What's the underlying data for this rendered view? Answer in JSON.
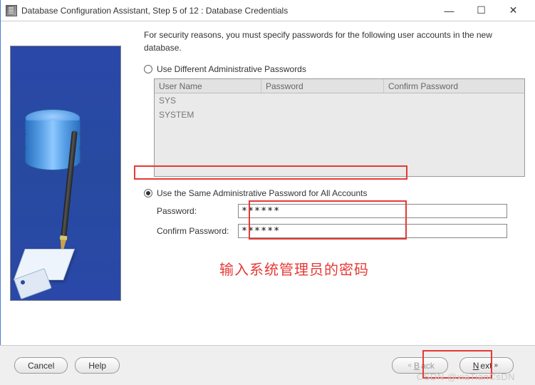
{
  "window": {
    "title": "Database Configuration Assistant, Step 5 of 12 : Database Credentials"
  },
  "intro": "For security reasons, you must specify passwords for the following user accounts in the new database.",
  "option1": {
    "label": "Use Different Administrative Passwords",
    "selected": false
  },
  "table": {
    "headers": {
      "user": "User Name",
      "pwd": "Password",
      "cpwd": "Confirm Password"
    },
    "rows": [
      {
        "user": "SYS"
      },
      {
        "user": "SYSTEM"
      }
    ]
  },
  "option2": {
    "label": "Use the Same Administrative Password for All Accounts",
    "selected": true
  },
  "fields": {
    "password_label": "Password:",
    "password_value": "******",
    "confirm_label": "Confirm Password:",
    "confirm_value": "******"
  },
  "annotation": "输入系统管理员的密码",
  "buttons": {
    "cancel": "Cancel",
    "help": "Help",
    "back": "Back",
    "next": "Next"
  },
  "watermark": "CSDN @xiaTianCsDN"
}
